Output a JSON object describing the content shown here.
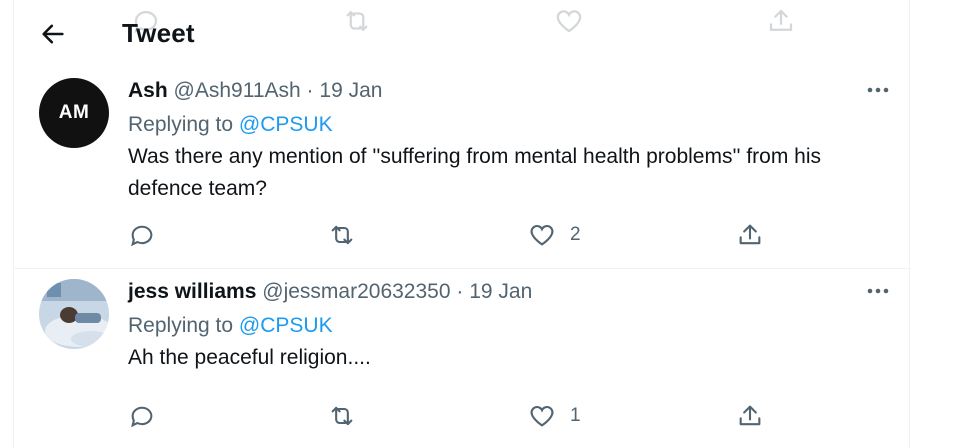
{
  "header": {
    "title": "Tweet"
  },
  "tweets": [
    {
      "avatar_initials": "AM",
      "name": "Ash",
      "handle": "@Ash911Ash",
      "separator": "·",
      "date": "19 Jan",
      "replying_prefix": "Replying to",
      "replying_to": "@CPSUK",
      "text": "Was there any mention of ''suffering from mental health problems'' from his defence team?",
      "like_count": "2"
    },
    {
      "name": "jess williams",
      "handle": "@jessmar20632350",
      "separator": "·",
      "date": "19 Jan",
      "replying_prefix": "Replying to",
      "replying_to": "@CPSUK",
      "text": "Ah the peaceful religion....",
      "like_count": "1"
    }
  ],
  "colors": {
    "link": "#1d9bf0",
    "muted": "#536471",
    "text": "#0f1419",
    "border": "#eff3f4"
  },
  "icons": [
    "back-arrow-icon",
    "more-icon",
    "reply-icon",
    "retweet-icon",
    "like-icon",
    "share-icon"
  ]
}
